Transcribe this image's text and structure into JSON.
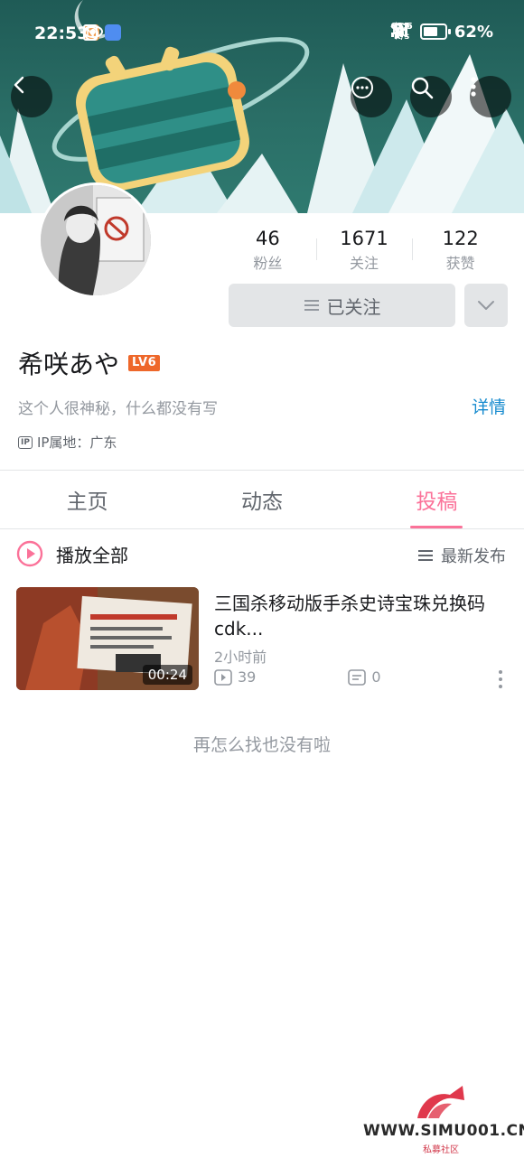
{
  "status_bar": {
    "time": "22:53",
    "net_speed_value": "62.5",
    "net_speed_unit": "K/s",
    "battery": "62%"
  },
  "stats": [
    {
      "value": "46",
      "label": "粉丝"
    },
    {
      "value": "1671",
      "label": "关注"
    },
    {
      "value": "122",
      "label": "获赞"
    }
  ],
  "follow_button": {
    "label": "已关注"
  },
  "user": {
    "name": "希咲あや",
    "level": "LV6",
    "bio": "这个人很神秘，什么都没有写",
    "detail_link": "详情",
    "ip_icon": "IP",
    "ip_location": "IP属地：广东"
  },
  "tabs": [
    {
      "label": "主页",
      "active": false
    },
    {
      "label": "动态",
      "active": false
    },
    {
      "label": "投稿",
      "active": true
    }
  ],
  "list_header": {
    "play_all": "播放全部",
    "sort": "最新发布"
  },
  "video": {
    "title": "三国杀移动版手杀史诗宝珠兑换码cdk...",
    "duration": "00:24",
    "time": "2小时前",
    "plays": "39",
    "comments": "0"
  },
  "end_text": "再怎么找也没有啦",
  "watermark": {
    "site": "WWW.SIMU001.CN",
    "sub": "私募社区"
  },
  "colors": {
    "accent_pink": "#fb7299",
    "link_blue": "#178bcf",
    "level_orange": "#ee672a",
    "banner_teal": "#2a6e66"
  }
}
